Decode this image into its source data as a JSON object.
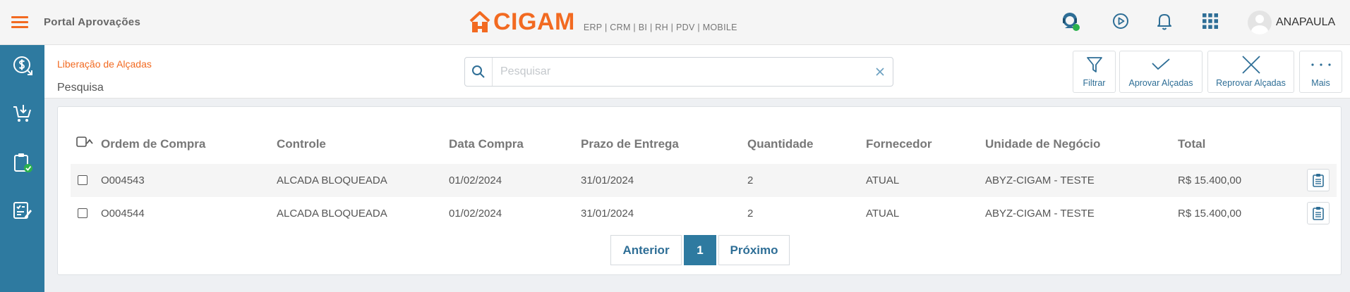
{
  "header": {
    "portal_title": "Portal Aprovações",
    "logo_text": "CIGAM",
    "logo_subtitle": "ERP | CRM | BI | RH | PDV | MOBILE",
    "user_name": "ANAPAULA",
    "icons": [
      "support-agent-icon",
      "play-icon",
      "bell-icon",
      "apps-grid-icon",
      "user-avatar"
    ]
  },
  "sidebar": {
    "items": [
      "dollar-refresh-icon",
      "cart-download-icon",
      "clipboard-check-icon",
      "checklist-edit-icon"
    ]
  },
  "subheader": {
    "breadcrumb": "Liberação de Alçadas",
    "page_title": "Pesquisa",
    "search_placeholder": "Pesquisar",
    "search_value": "",
    "actions": {
      "filter": "Filtrar",
      "approve": "Aprovar Alçadas",
      "reject": "Reprovar Alçadas",
      "more": "Mais"
    }
  },
  "table": {
    "columns": [
      "Ordem de Compra",
      "Controle",
      "Data Compra",
      "Prazo de Entrega",
      "Quantidade",
      "Fornecedor",
      "Unidade de Negócio",
      "Total"
    ],
    "rows": [
      [
        "O004543",
        "ALCADA BLOQUEADA",
        "01/02/2024",
        "31/01/2024",
        "2",
        "ATUAL",
        "ABYZ-CIGAM - TESTE",
        "R$ 15.400,00"
      ],
      [
        "O004544",
        "ALCADA BLOQUEADA",
        "01/02/2024",
        "31/01/2024",
        "2",
        "ATUAL",
        "ABYZ-CIGAM - TESTE",
        "R$ 15.400,00"
      ]
    ]
  },
  "pagination": {
    "prev": "Anterior",
    "current": "1",
    "next": "Próximo"
  },
  "colors": {
    "brand_orange": "#f26a21",
    "primary_blue": "#2e7aa0",
    "status_green": "#2bb24c"
  }
}
